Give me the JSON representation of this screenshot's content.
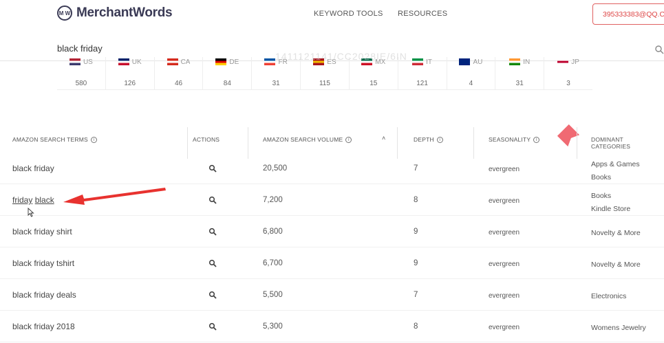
{
  "header": {
    "logo_mark": "M W",
    "logo_text": "MerchantWords",
    "nav": [
      "KEYWORD TOOLS",
      "RESOURCES"
    ],
    "account": "395333383@QQ.CO"
  },
  "search": {
    "value": "black friday"
  },
  "watermark": "1411121141/CC2028IE/6IN",
  "markets": [
    {
      "code": "US",
      "count": "580",
      "colors": [
        "#b22234",
        "#ffffff",
        "#3c3b6e"
      ]
    },
    {
      "code": "UK",
      "count": "126",
      "colors": [
        "#012169",
        "#ffffff",
        "#c8102e"
      ]
    },
    {
      "code": "CA",
      "count": "46",
      "colors": [
        "#d52b1e",
        "#ffffff",
        "#d52b1e"
      ]
    },
    {
      "code": "DE",
      "count": "84",
      "colors": [
        "#000000",
        "#dd0000",
        "#ffce00"
      ]
    },
    {
      "code": "FR",
      "count": "31",
      "colors": [
        "#0055a4",
        "#ffffff",
        "#ef4135"
      ]
    },
    {
      "code": "ES",
      "count": "115",
      "colors": [
        "#aa151b",
        "#f1bf00",
        "#aa151b"
      ]
    },
    {
      "code": "MX",
      "count": "15",
      "colors": [
        "#006847",
        "#ffffff",
        "#ce1126"
      ]
    },
    {
      "code": "IT",
      "count": "121",
      "colors": [
        "#009246",
        "#ffffff",
        "#ce2b37"
      ]
    },
    {
      "code": "AU",
      "count": "4",
      "colors": [
        "#00247d",
        "#00247d",
        "#00247d"
      ]
    },
    {
      "code": "IN",
      "count": "31",
      "colors": [
        "#ff9933",
        "#ffffff",
        "#138808"
      ]
    },
    {
      "code": "JP",
      "count": "3",
      "colors": [
        "#ffffff",
        "#bc002d",
        "#ffffff"
      ]
    }
  ],
  "table": {
    "headers": {
      "term": "AMAZON SEARCH TERMS",
      "actions": "ACTIONS",
      "volume": "AMAZON SEARCH VOLUME",
      "depth": "DEPTH",
      "seasonality": "SEASONALITY",
      "categories": "DOMINANT CATEGORIES"
    },
    "rows": [
      {
        "term": "black friday",
        "volume": "20,500",
        "depth": "7",
        "seasonality": "evergreen",
        "categories": [
          "Apps & Games",
          "Books"
        ]
      },
      {
        "term_words": [
          "friday",
          "black"
        ],
        "volume": "7,200",
        "depth": "8",
        "seasonality": "evergreen",
        "categories": [
          "Books",
          "Kindle Store"
        ]
      },
      {
        "term": "black friday shirt",
        "volume": "6,800",
        "depth": "9",
        "seasonality": "evergreen",
        "categories": [
          "Novelty & More"
        ]
      },
      {
        "term": "black friday tshirt",
        "volume": "6,700",
        "depth": "9",
        "seasonality": "evergreen",
        "categories": [
          "Novelty & More"
        ]
      },
      {
        "term": "black friday deals",
        "volume": "5,500",
        "depth": "7",
        "seasonality": "evergreen",
        "categories": [
          "Electronics"
        ]
      },
      {
        "term": "black friday 2018",
        "volume": "5,300",
        "depth": "8",
        "seasonality": "evergreen",
        "categories": [
          "Womens Jewelry"
        ]
      }
    ]
  },
  "colors": {
    "accent": "#e06060",
    "arrow": "#e8322f",
    "brand": "#3a3a55"
  }
}
